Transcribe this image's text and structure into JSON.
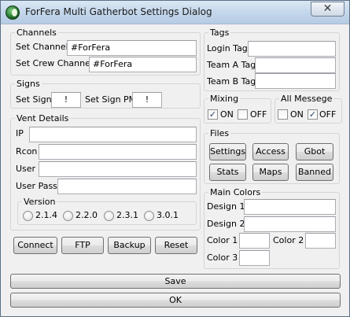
{
  "window": {
    "title": "ForFera Multi Gatherbot Settings Dialog",
    "close_glyph": "✕",
    "icon": "app-globe-icon"
  },
  "channels": {
    "title": "Channels",
    "set_channel_label": "Set Channel",
    "set_channel_value": "#ForFera",
    "set_crew_channel_label": "Set Crew Channel",
    "set_crew_channel_value": "#ForFera"
  },
  "signs": {
    "title": "Signs",
    "set_sign_label": "Set Sign",
    "set_sign_value": "!",
    "set_sign_pm_label": "Set Sign PM",
    "set_sign_pm_value": "!"
  },
  "vent": {
    "title": "Vent Details",
    "ip_label": "IP",
    "ip_value": "",
    "rcon_label": "Rcon",
    "rcon_value": "",
    "user_label": "User",
    "user_value": "",
    "user_pass_label": "User Pass",
    "user_pass_value": ""
  },
  "version": {
    "title": "Version",
    "options": [
      "2.1.4",
      "2.2.0",
      "2.3.1",
      "3.0.1"
    ]
  },
  "actions": {
    "connect": "Connect",
    "ftp": "FTP",
    "backup": "Backup",
    "reset": "Reset"
  },
  "tags": {
    "title": "Tags",
    "login_label": "Login Tag",
    "login_value": "",
    "team_a_label": "Team A Tag",
    "team_a_value": "",
    "team_b_label": "Team B Tag",
    "team_b_value": ""
  },
  "mixing": {
    "title": "Mixing",
    "on_label": "ON",
    "off_label": "OFF",
    "on_checked": true,
    "off_checked": false
  },
  "all_message": {
    "title": "All Messege",
    "on_label": "ON",
    "off_label": "OFF",
    "on_checked": false,
    "off_checked": true
  },
  "files": {
    "title": "Files",
    "settings": "Settings",
    "access": "Access",
    "gbot": "Gbot",
    "stats": "Stats",
    "maps": "Maps",
    "banned": "Banned"
  },
  "colors": {
    "title": "Main Colors",
    "design1_label": "Design 1",
    "design2_label": "Design 2",
    "color1_label": "Color 1",
    "color2_label": "Color 2",
    "color3_label": "Color 3"
  },
  "bottom": {
    "save": "Save",
    "ok": "OK"
  },
  "check_mark": "✓"
}
